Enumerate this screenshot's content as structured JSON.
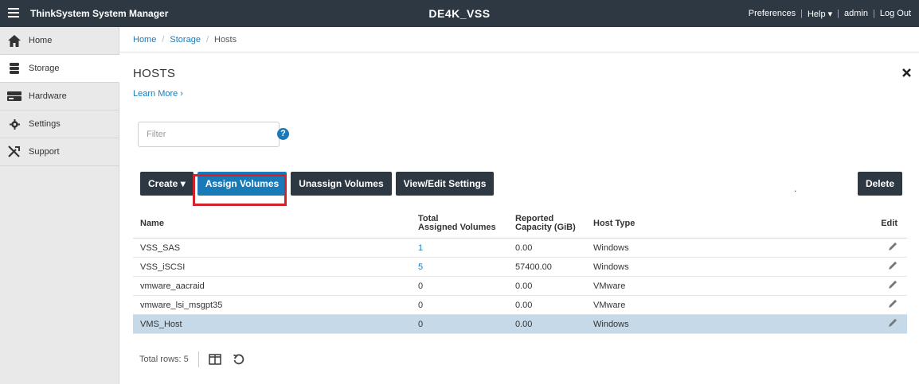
{
  "topbar": {
    "menu_icon": "hamburger-menu-icon",
    "app_title": "ThinkSystem System Manager",
    "system_name": "DE4K_VSS",
    "preferences": "Preferences",
    "help": "Help ▾",
    "user": "admin",
    "logout": "Log Out",
    "separator": "|"
  },
  "sidebar": {
    "items": [
      {
        "label": "Home",
        "icon": "home-icon"
      },
      {
        "label": "Storage",
        "icon": "database-icon"
      },
      {
        "label": "Hardware",
        "icon": "hardware-icon"
      },
      {
        "label": "Settings",
        "icon": "gear-icon"
      },
      {
        "label": "Support",
        "icon": "tools-icon"
      }
    ],
    "active": "Storage"
  },
  "breadcrumb": {
    "items": [
      "Home",
      "Storage",
      "Hosts"
    ],
    "separator": "/"
  },
  "page": {
    "title": "HOSTS",
    "learn_more": "Learn More ›",
    "close_icon": "close-icon"
  },
  "filter": {
    "placeholder": "Filter",
    "value": "",
    "help_icon": "?"
  },
  "toolbar": {
    "create": "Create ▾",
    "assign_volumes": "Assign Volumes",
    "unassign_volumes": "Unassign Volumes",
    "view_edit_settings": "View/Edit Settings",
    "dot": ".",
    "delete": "Delete"
  },
  "table": {
    "headers": {
      "name": "Name",
      "total_line1": "Total",
      "total_line2": "Assigned Volumes",
      "cap_line1": "Reported",
      "cap_line2": "Capacity (GiB)",
      "host_type": "Host Type",
      "edit": "Edit"
    },
    "rows": [
      {
        "name": "VSS_SAS",
        "total": "1",
        "capacity": "0.00",
        "host_type": "Windows"
      },
      {
        "name": "VSS_iSCSI",
        "total": "5",
        "capacity": "57400.00",
        "host_type": "Windows"
      },
      {
        "name": "vmware_aacraid",
        "total": "0",
        "capacity": "0.00",
        "host_type": "VMware"
      },
      {
        "name": "vmware_lsi_msgpt35",
        "total": "0",
        "capacity": "0.00",
        "host_type": "VMware"
      },
      {
        "name": "VMS_Host",
        "total": "0",
        "capacity": "0.00",
        "host_type": "Windows"
      }
    ],
    "selected_row": "VMS_Host",
    "footer": {
      "total_rows": "Total rows: 5",
      "columns_icon": "columns-icon",
      "refresh_icon": "refresh-icon"
    }
  },
  "colors": {
    "topbar": "#2d3842",
    "accent": "#1a7ab8",
    "highlight": "#d2232a",
    "selected_row": "#c5d9e8"
  }
}
